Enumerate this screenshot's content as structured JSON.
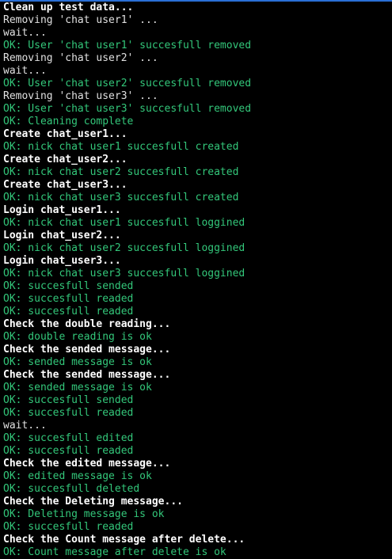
{
  "colors": {
    "background": "#000000",
    "heading": "#ffffff",
    "plain": "#e0e0e0",
    "ok": "#33c77a",
    "top_accent": "#2a6fd6"
  },
  "lines": [
    {
      "kind": "heading",
      "text": "Clean up test data..."
    },
    {
      "kind": "plain",
      "text": "Removing 'chat user1' ..."
    },
    {
      "kind": "plain",
      "text": "wait..."
    },
    {
      "kind": "ok",
      "text": "OK: User 'chat user1' succesfull removed"
    },
    {
      "kind": "plain",
      "text": "Removing 'chat user2' ..."
    },
    {
      "kind": "plain",
      "text": "wait..."
    },
    {
      "kind": "ok",
      "text": "OK: User 'chat user2' succesfull removed"
    },
    {
      "kind": "plain",
      "text": "Removing 'chat user3' ..."
    },
    {
      "kind": "ok",
      "text": "OK: User 'chat user3' succesfull removed"
    },
    {
      "kind": "ok",
      "text": "OK: Cleaning complete"
    },
    {
      "kind": "heading",
      "text": "Create chat_user1..."
    },
    {
      "kind": "ok",
      "text": "OK: nick chat user1 succesfull created"
    },
    {
      "kind": "heading",
      "text": "Create chat_user2..."
    },
    {
      "kind": "ok",
      "text": "OK: nick chat user2 succesfull created"
    },
    {
      "kind": "heading",
      "text": "Create chat_user3..."
    },
    {
      "kind": "ok",
      "text": "OK: nick chat user3 succesfull created"
    },
    {
      "kind": "heading",
      "text": "Login chat_user1..."
    },
    {
      "kind": "ok",
      "text": "OK: nick chat user1 succesfull loggined"
    },
    {
      "kind": "heading",
      "text": "Login chat_user2..."
    },
    {
      "kind": "ok",
      "text": "OK: nick chat user2 succesfull loggined"
    },
    {
      "kind": "heading",
      "text": "Login chat_user3..."
    },
    {
      "kind": "ok",
      "text": "OK: nick chat user3 succesfull loggined"
    },
    {
      "kind": "ok",
      "text": "OK: succesfull sended"
    },
    {
      "kind": "ok",
      "text": "OK: succesfull readed"
    },
    {
      "kind": "ok",
      "text": "OK: succesfull readed"
    },
    {
      "kind": "heading",
      "text": "Check the double reading..."
    },
    {
      "kind": "ok",
      "text": "OK: double reading is ok"
    },
    {
      "kind": "heading",
      "text": "Check the sended message..."
    },
    {
      "kind": "ok",
      "text": "OK: sended message is ok"
    },
    {
      "kind": "heading",
      "text": "Check the sended message..."
    },
    {
      "kind": "ok",
      "text": "OK: sended message is ok"
    },
    {
      "kind": "ok",
      "text": "OK: succesfull sended"
    },
    {
      "kind": "ok",
      "text": "OK: succesfull readed"
    },
    {
      "kind": "plain",
      "text": "wait..."
    },
    {
      "kind": "ok",
      "text": "OK: succesfull edited"
    },
    {
      "kind": "ok",
      "text": "OK: succesfull readed"
    },
    {
      "kind": "heading",
      "text": "Check the edited message..."
    },
    {
      "kind": "ok",
      "text": "OK: edited message is ok"
    },
    {
      "kind": "ok",
      "text": "OK: succesfull deleted"
    },
    {
      "kind": "heading",
      "text": "Check the Deleting message..."
    },
    {
      "kind": "ok",
      "text": "OK: Deleting message is ok"
    },
    {
      "kind": "ok",
      "text": "OK: succesfull readed"
    },
    {
      "kind": "heading",
      "text": "Check the Count message after delete..."
    },
    {
      "kind": "ok",
      "text": "OK: Count message after delete is ok"
    }
  ]
}
